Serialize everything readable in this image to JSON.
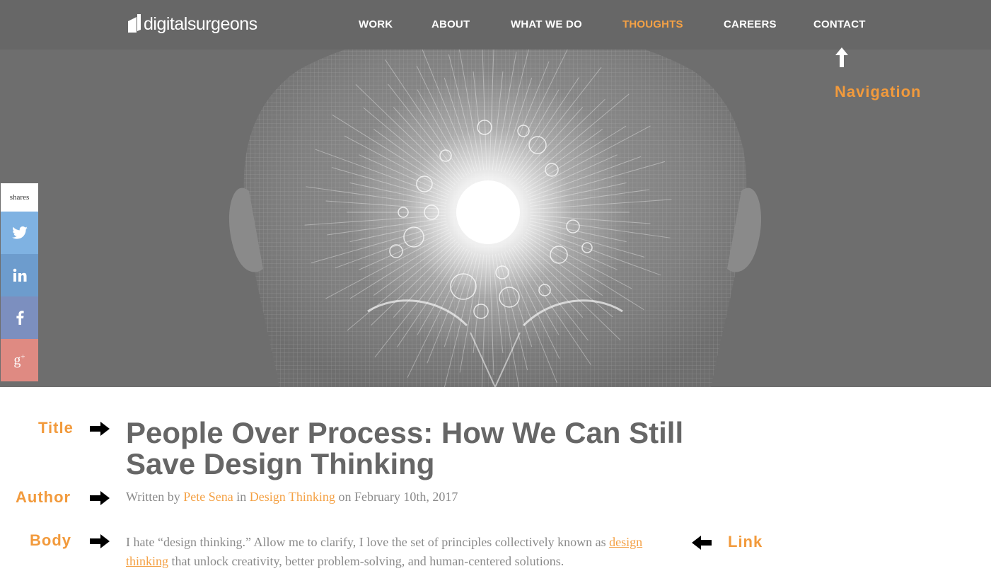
{
  "header": {
    "logo_text": "digitalsurgeons",
    "nav": [
      {
        "label": "WORK",
        "active": false
      },
      {
        "label": "ABOUT",
        "active": false
      },
      {
        "label": "WHAT WE DO",
        "active": false
      },
      {
        "label": "THOUGHTS",
        "active": true
      },
      {
        "label": "CAREERS",
        "active": false
      },
      {
        "label": "CONTACT",
        "active": false
      }
    ]
  },
  "share": {
    "count_label": "shares",
    "buttons": [
      {
        "network": "twitter",
        "icon": "twitter-icon",
        "color": "#7fb2e2"
      },
      {
        "network": "linkedin",
        "icon": "linkedin-icon",
        "color": "#6d9ccd"
      },
      {
        "network": "facebook",
        "icon": "facebook-icon",
        "color": "#7c8fbf"
      },
      {
        "network": "google-plus",
        "icon": "google-plus-icon",
        "color": "#df8a82"
      }
    ]
  },
  "annotations": {
    "navigation": "Navigation",
    "title": "Title",
    "author": "Author",
    "body": "Body",
    "link": "Link"
  },
  "article": {
    "title": "People Over Process: How We Can Still Save Design Thinking",
    "byline": {
      "prefix": "Written by",
      "author": "Pete Sena",
      "in": "in",
      "category": "Design Thinking",
      "on": "on February 10th, 2017"
    },
    "body": {
      "before_link": "I hate “design thinking.” Allow me to clarify, I love the set of principles collectively known as",
      "link": "design thinking",
      "after_link": "that unlock creativity, better problem-solving, and human-centered solutions."
    }
  },
  "colors": {
    "accent": "#f4a145",
    "header_bg": "#676767",
    "title_text": "#666666"
  }
}
